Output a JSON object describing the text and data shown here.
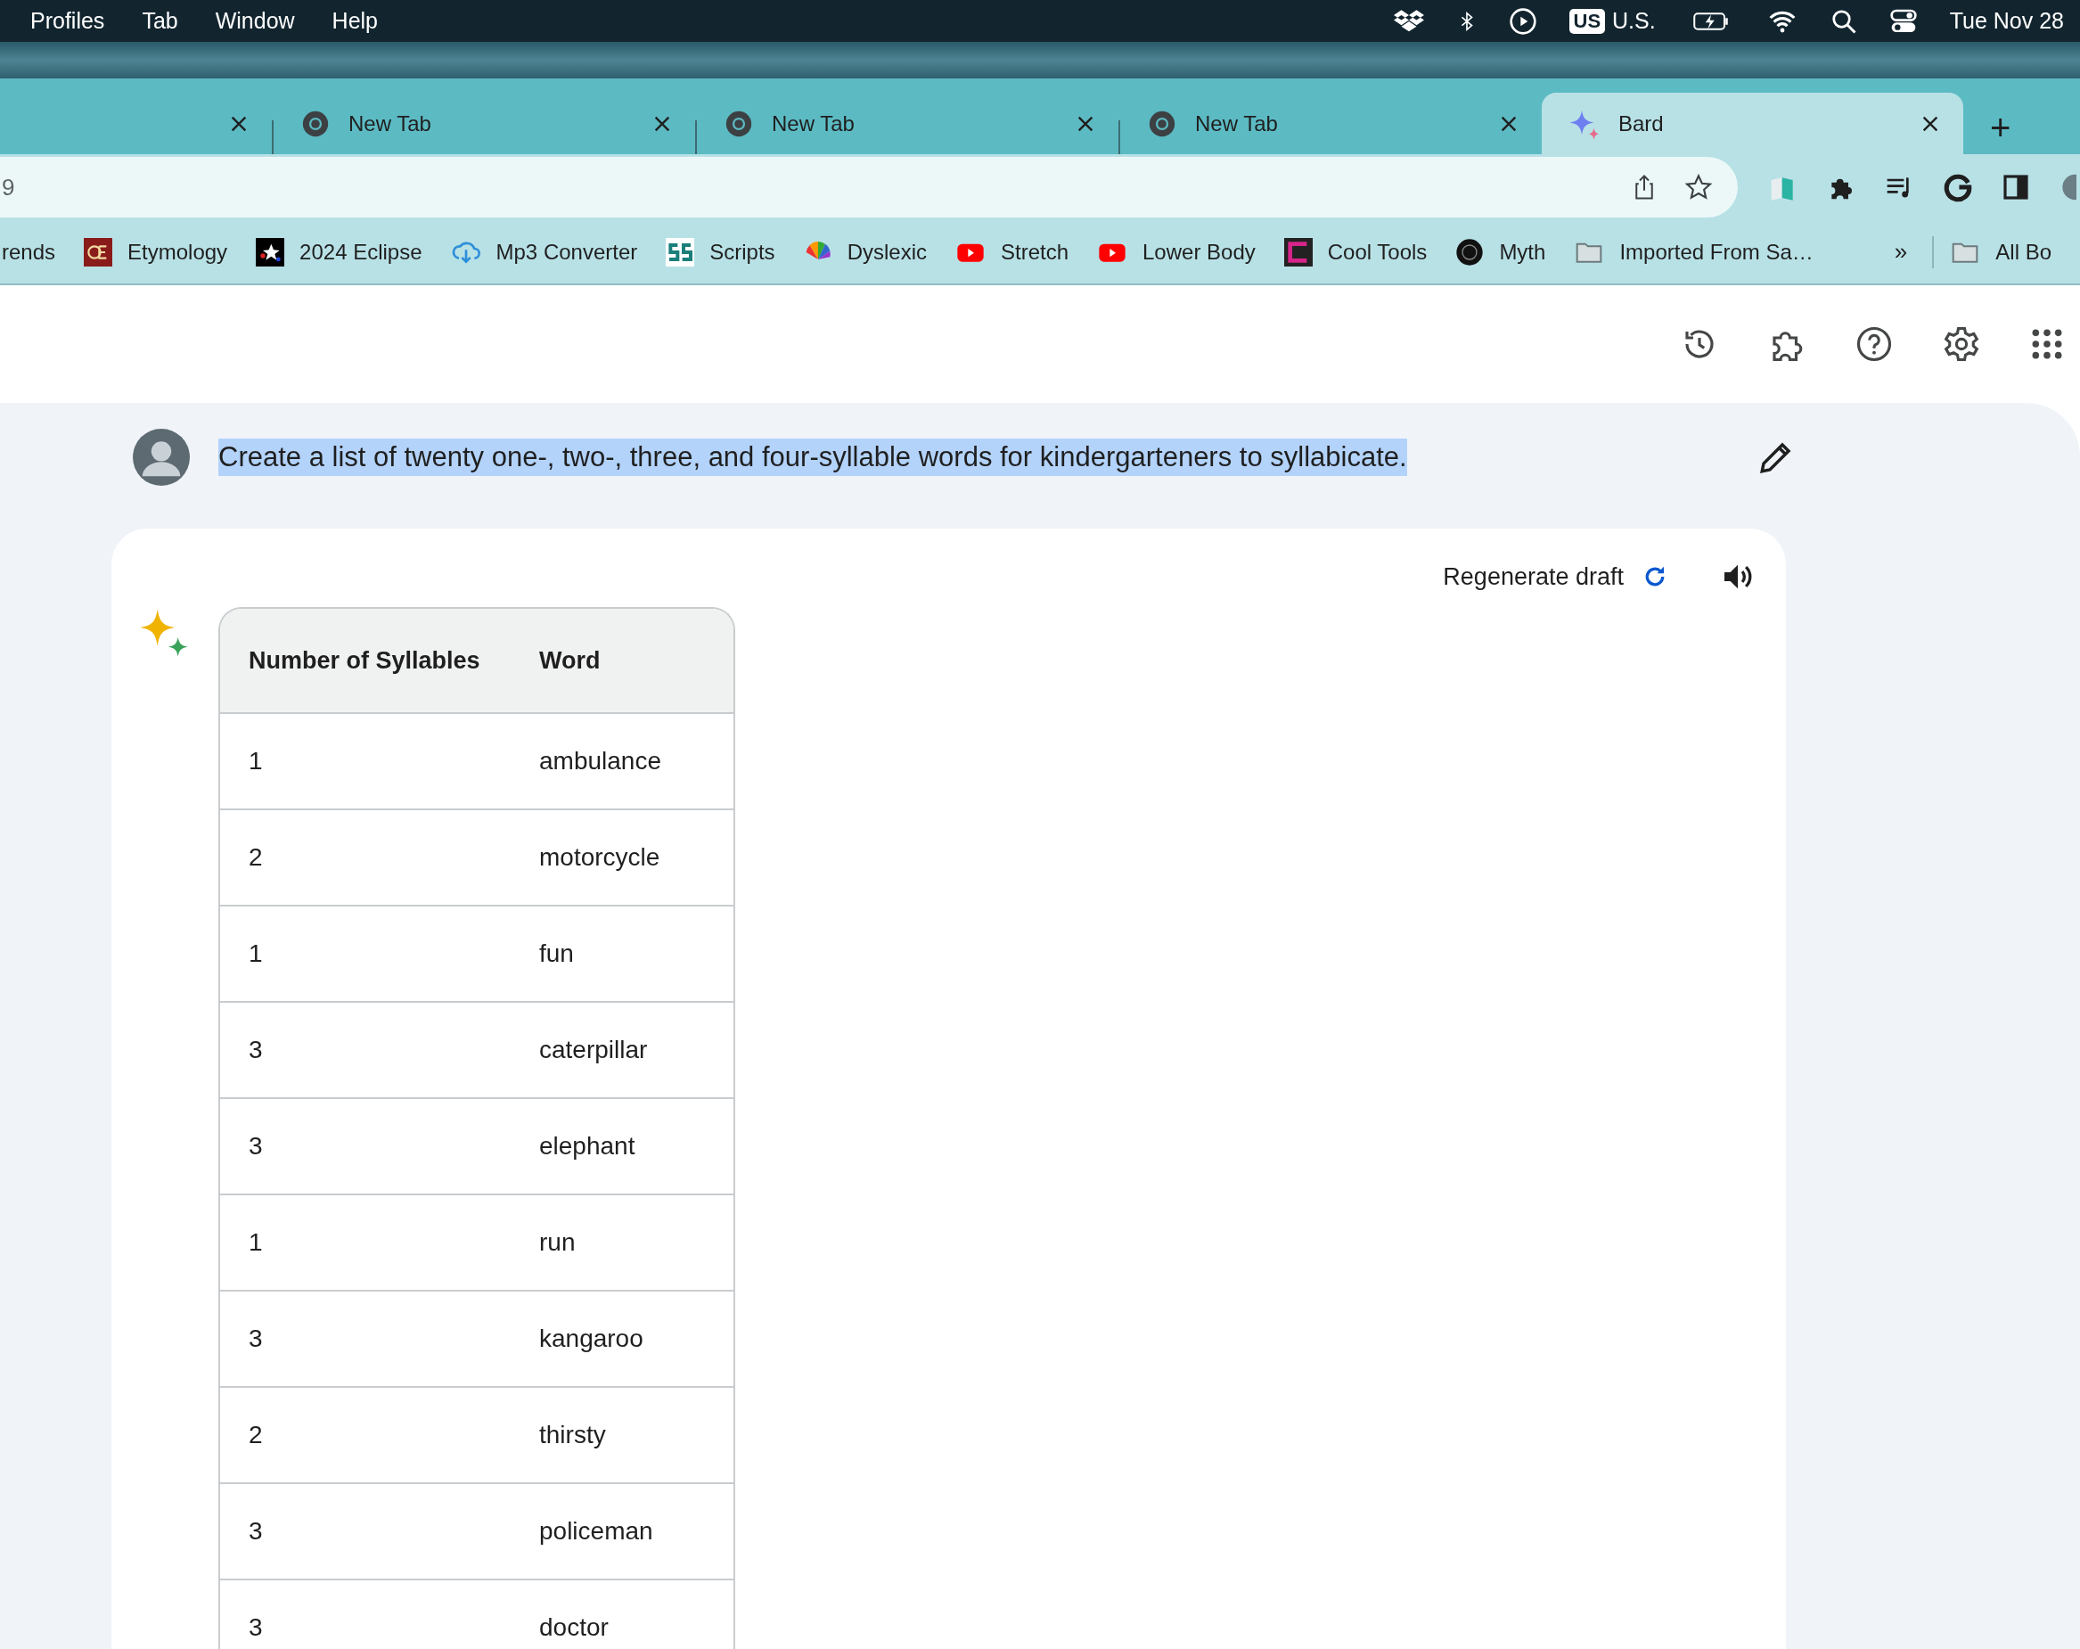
{
  "menu_bar": {
    "menus": [
      "Profiles",
      "Tab",
      "Window",
      "Help"
    ],
    "input_source_badge": "US",
    "input_source": "U.S.",
    "clock": "Tue Nov 28"
  },
  "tabs": [
    {
      "kind": "cut",
      "selected": false
    },
    {
      "kind": "newtab",
      "title": "New Tab",
      "selected": false
    },
    {
      "kind": "newtab",
      "title": "New Tab",
      "selected": false
    },
    {
      "kind": "newtab",
      "title": "New Tab",
      "selected": false
    },
    {
      "kind": "bard",
      "title": "Bard",
      "selected": true
    }
  ],
  "new_tab_button": "+",
  "address_bar": {
    "value": "9"
  },
  "bookmarks": [
    {
      "kind": "cut",
      "label": "rends"
    },
    {
      "kind": "oe",
      "label": "Etymology"
    },
    {
      "kind": "star",
      "label": "2024 Eclipse"
    },
    {
      "kind": "cloud",
      "label": "Mp3 Converter"
    },
    {
      "kind": "ss",
      "label": "Scripts"
    },
    {
      "kind": "rainbow",
      "label": "Dyslexic"
    },
    {
      "kind": "youtube",
      "label": "Stretch"
    },
    {
      "kind": "youtube",
      "label": "Lower Body"
    },
    {
      "kind": "magenta",
      "label": "Cool Tools"
    },
    {
      "kind": "round",
      "label": "Myth"
    },
    {
      "kind": "folder",
      "label": "Imported From Sa…"
    }
  ],
  "bookmarks_overflow": "»",
  "other_bookmarks": "All Bo",
  "prompt": {
    "text": "Create a list of twenty one-, two-, three, and four-syllable words for kindergarteners to syllabicate.",
    "highlighted": true
  },
  "response": {
    "regenerate": "Regenerate draft",
    "table": {
      "columns": [
        "Number of Syllables",
        "Word"
      ],
      "rows": [
        [
          "1",
          "ambulance"
        ],
        [
          "2",
          "motorcycle"
        ],
        [
          "1",
          "fun"
        ],
        [
          "3",
          "caterpillar"
        ],
        [
          "3",
          "elephant"
        ],
        [
          "1",
          "run"
        ],
        [
          "3",
          "kangaroo"
        ],
        [
          "2",
          "thirsty"
        ],
        [
          "3",
          "policeman"
        ],
        [
          "3",
          "doctor"
        ]
      ]
    }
  }
}
